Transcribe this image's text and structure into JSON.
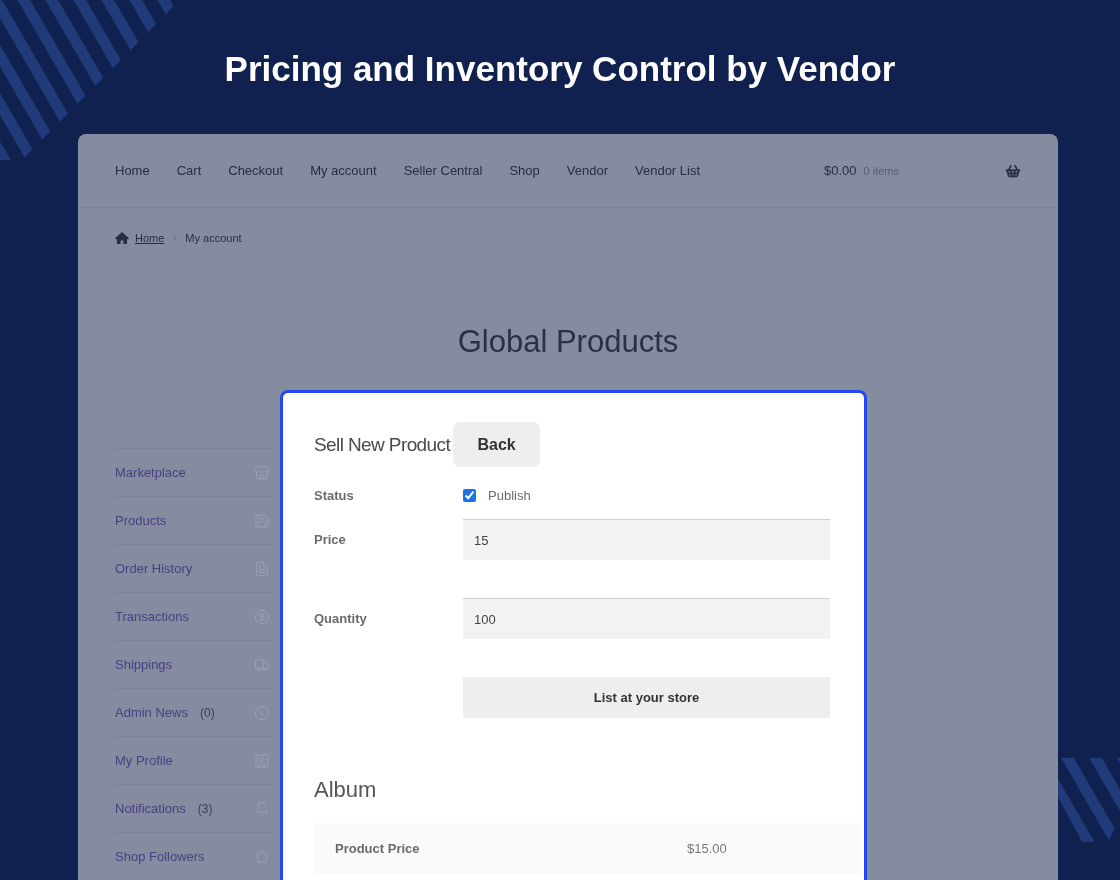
{
  "banner": {
    "title": "Pricing and Inventory Control by Vendor"
  },
  "nav": {
    "links": [
      "Home",
      "Cart",
      "Checkout",
      "My account",
      "Seller Central",
      "Shop",
      "Vendor",
      "Vendor List"
    ],
    "cart": {
      "total": "$0.00",
      "count": "0 items"
    }
  },
  "breadcrumb": [
    {
      "label": "Home",
      "kind": "link"
    },
    {
      "label": "My account",
      "kind": "current"
    }
  ],
  "page_title": "Global Products",
  "sidebar": {
    "items": [
      {
        "label": "Marketplace"
      },
      {
        "label": "Products"
      },
      {
        "label": "Order History"
      },
      {
        "label": "Transactions"
      },
      {
        "label": "Shippings"
      },
      {
        "label": "Admin News",
        "count": "(0)"
      },
      {
        "label": "My Profile"
      },
      {
        "label": "Notifications",
        "count": "(3)"
      },
      {
        "label": "Shop Followers"
      }
    ]
  },
  "form": {
    "title": "Sell New Product",
    "back_button": "Back",
    "fields": [
      {
        "kind": "checkbox",
        "label": "Status",
        "option": "Publish",
        "checked": true
      },
      {
        "kind": "text",
        "label": "Price",
        "value": "15"
      },
      {
        "kind": "text",
        "label": "Quantity",
        "value": "100"
      }
    ],
    "submit_button": "List at your store"
  },
  "product": {
    "title": "Album",
    "rows": [
      {
        "label": "Product Price",
        "value": "$15.00"
      }
    ]
  }
}
